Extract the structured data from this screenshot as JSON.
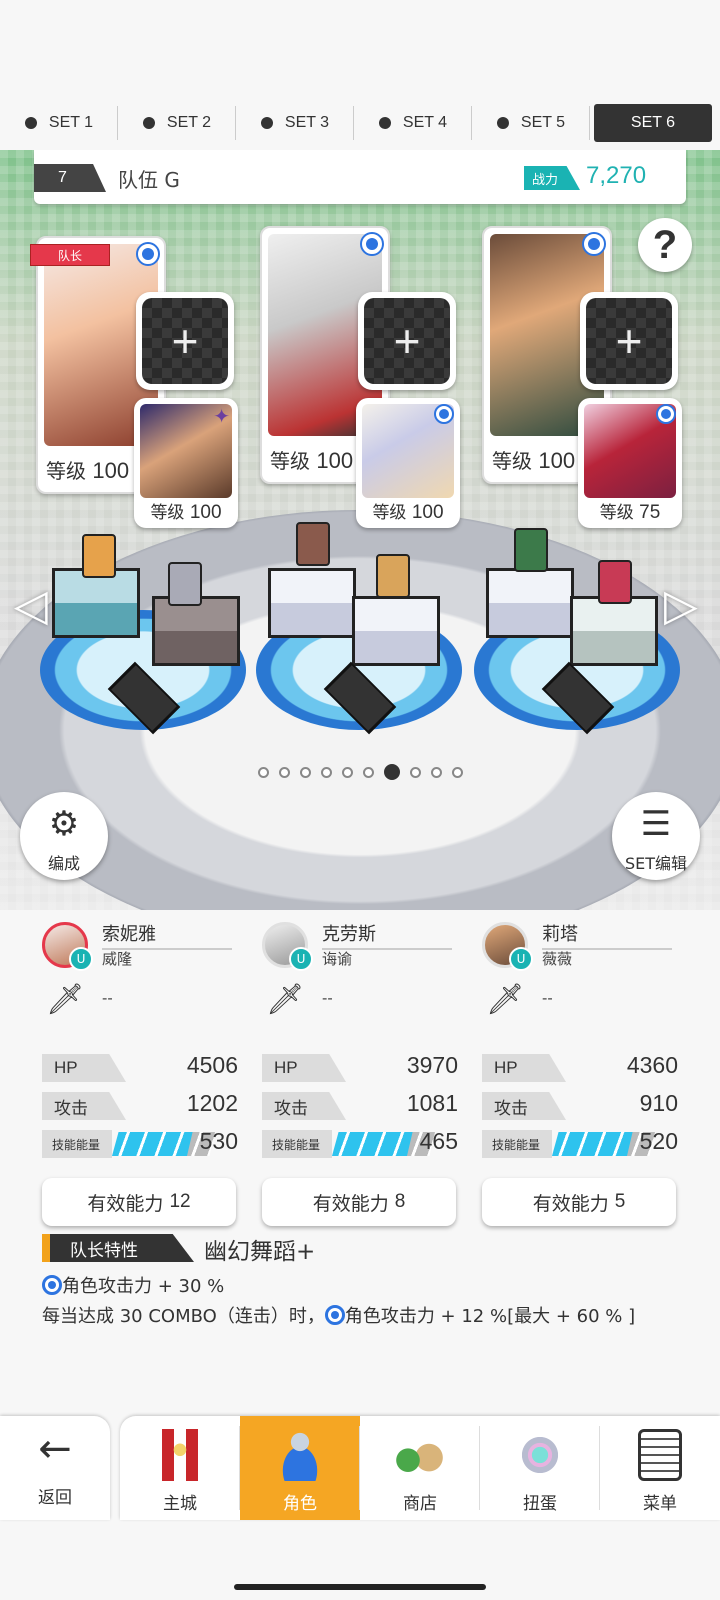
{
  "set_tabs": [
    {
      "label": "SET 1",
      "active": false
    },
    {
      "label": "SET 2",
      "active": false
    },
    {
      "label": "SET 3",
      "active": false
    },
    {
      "label": "SET 4",
      "active": false
    },
    {
      "label": "SET 5",
      "active": false
    },
    {
      "label": "SET 6",
      "active": true
    }
  ],
  "team": {
    "number": "7",
    "name": "队伍 G",
    "power_label": "战力",
    "power_value": "7,270"
  },
  "help_label": "?",
  "leader_badge": "队长",
  "level_prefix": "等级",
  "cards": [
    {
      "main_level": "100",
      "sub_level": "100"
    },
    {
      "main_level": "100",
      "sub_level": "100"
    },
    {
      "main_level": "100",
      "sub_level": "75"
    }
  ],
  "page_dots": {
    "count": 10,
    "active_index": 6
  },
  "buttons": {
    "formation": "编成",
    "set_edit": "SET编辑"
  },
  "characters": [
    {
      "name": "索妮雅",
      "nickname": "威隆",
      "weapon": "--",
      "hp_label": "HP",
      "hp": "4506",
      "atk_label": "攻击",
      "atk": "1202",
      "energy_label": "技能能量",
      "energy": "530",
      "ability_label": "有效能力",
      "ability": "12"
    },
    {
      "name": "克劳斯",
      "nickname": "诲谕",
      "weapon": "--",
      "hp_label": "HP",
      "hp": "3970",
      "atk_label": "攻击",
      "atk": "1081",
      "energy_label": "技能能量",
      "energy": "465",
      "ability_label": "有效能力",
      "ability": "8"
    },
    {
      "name": "莉塔",
      "nickname": "薇薇",
      "weapon": "--",
      "hp_label": "HP",
      "hp": "4360",
      "atk_label": "攻击",
      "atk": "910",
      "energy_label": "技能能量",
      "energy": "520",
      "ability_label": "有效能力",
      "ability": "5"
    }
  ],
  "leader_trait": {
    "label": "队长特性",
    "name": "幽幻舞蹈+",
    "line1": "角色攻击力 + 30 %",
    "line2_a": "每当达成 30 COMBO（连击）时，",
    "line2_b": "角色攻击力 + 12 %[最大 + 60 % ]"
  },
  "nav": {
    "back": "返回",
    "items": [
      {
        "label": "主城",
        "active": false
      },
      {
        "label": "角色",
        "active": true
      },
      {
        "label": "商店",
        "active": false
      },
      {
        "label": "扭蛋",
        "active": false
      },
      {
        "label": "菜单",
        "active": false
      }
    ]
  },
  "colors": {
    "accent_teal": "#1ab3b3",
    "nav_active": "#f5a623",
    "leader_red": "#e5384b",
    "select_blue": "#2d74e0"
  }
}
